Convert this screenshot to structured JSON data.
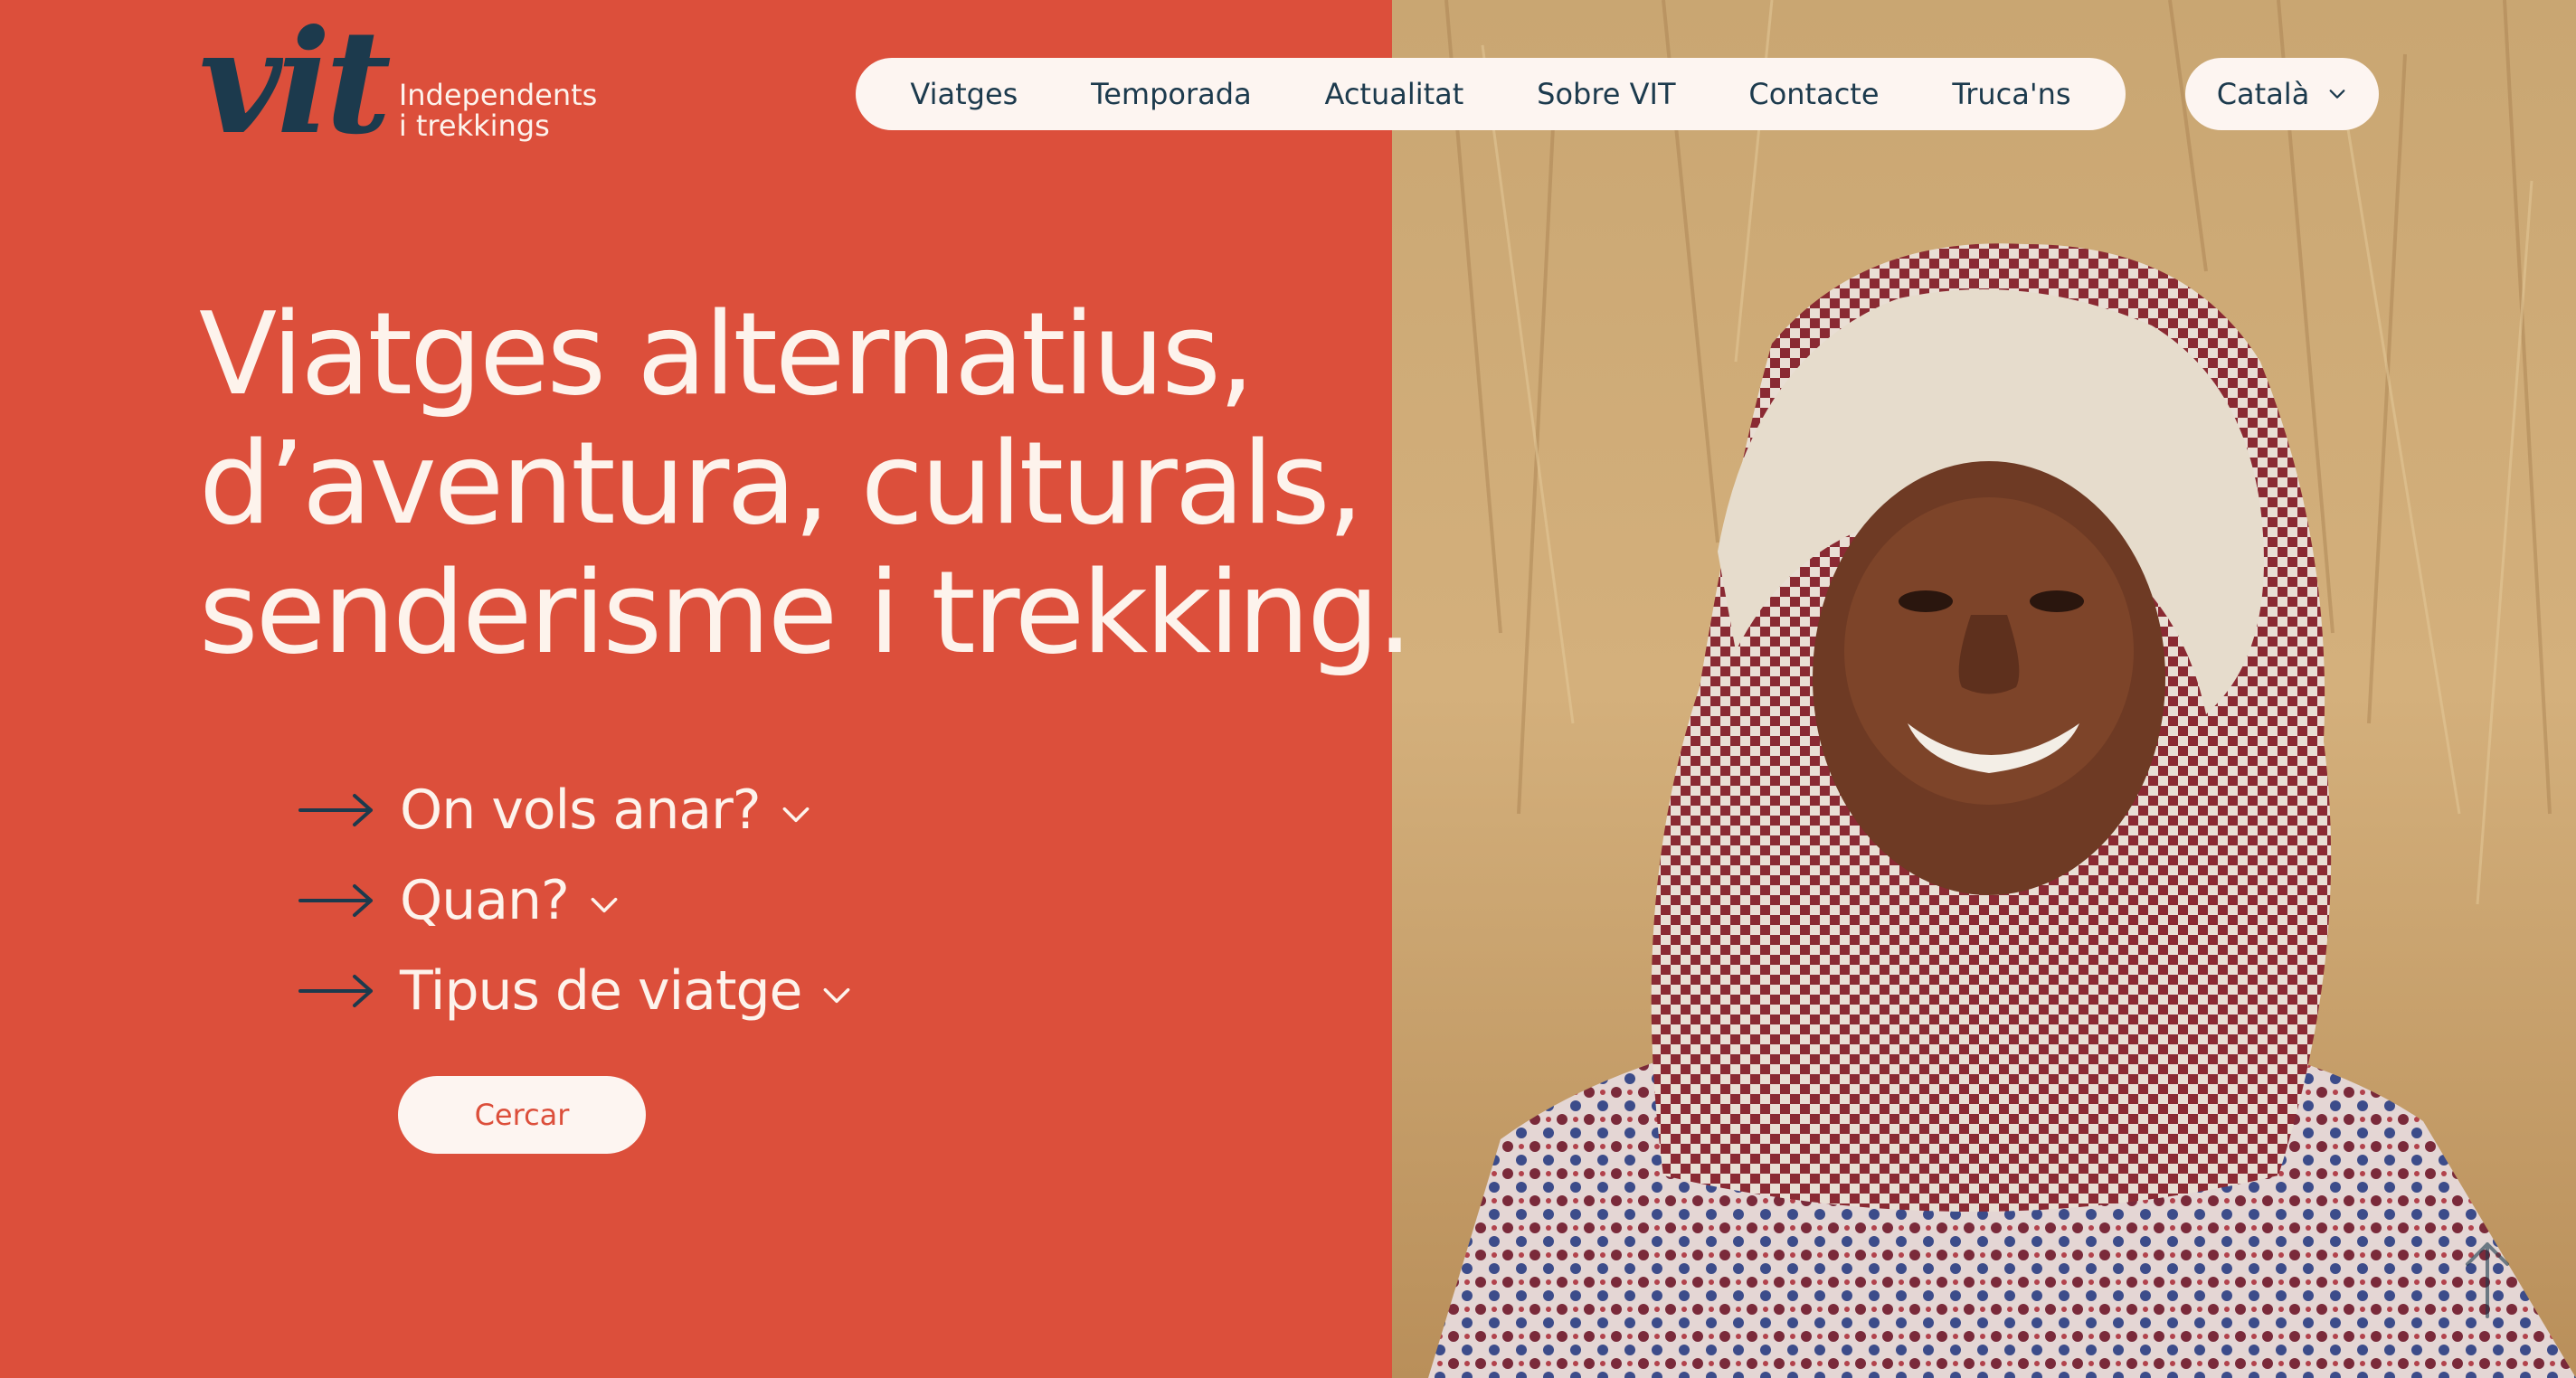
{
  "logo": {
    "mark": "vit",
    "tagline_line1": "Independents",
    "tagline_line2": "i trekkings"
  },
  "nav": {
    "items": [
      {
        "label": "Viatges"
      },
      {
        "label": "Temporada"
      },
      {
        "label": "Actualitat"
      },
      {
        "label": "Sobre VIT"
      },
      {
        "label": "Contacte"
      },
      {
        "label": "Truca'ns"
      }
    ]
  },
  "language": {
    "selected": "Català",
    "icon": "chevron-down-icon"
  },
  "hero": {
    "headline_line1": "Viatges alternatius,",
    "headline_line2": "d’aventura, culturals,",
    "headline_line3": "senderisme i trekking.",
    "photo_description_icon": "hero-photo"
  },
  "filters": {
    "where": "On vols anar?",
    "when": "Quan?",
    "trip_type": "Tipus de viatge"
  },
  "search": {
    "button_label": "Cercar"
  },
  "colors": {
    "brand_red": "#dc4f3b",
    "navy": "#1c3a4d",
    "cream": "#fdf5f1"
  }
}
